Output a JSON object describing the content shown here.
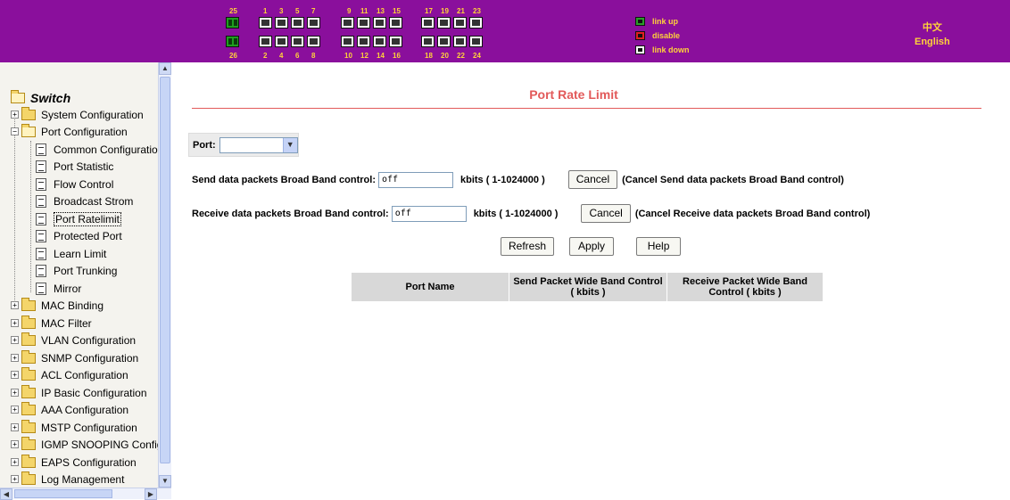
{
  "topbar": {
    "ports_top_gig": "25",
    "ports_bottom_gig": "26",
    "top_numbers": [
      "1",
      "3",
      "5",
      "7",
      "9",
      "11",
      "13",
      "15",
      "17",
      "19",
      "21",
      "23"
    ],
    "bottom_numbers": [
      "2",
      "4",
      "6",
      "8",
      "10",
      "12",
      "14",
      "16",
      "18",
      "20",
      "22",
      "24"
    ],
    "legend": [
      {
        "label": "link up",
        "color": "#2a9d2a"
      },
      {
        "label": "disable",
        "color": "#e02020"
      },
      {
        "label": "link down",
        "color": "#ffffff"
      }
    ],
    "lang_chinese": "中文",
    "lang_english": "English",
    "colors": {
      "bar": "#8a0f9c",
      "text": "#ffd23a"
    }
  },
  "sidebar": {
    "root_label": "Switch",
    "items": [
      {
        "label": "System Configuration",
        "type": "folder",
        "expanded": false
      },
      {
        "label": "Port Configuration",
        "type": "folder",
        "expanded": true
      },
      {
        "label": "Common Configuration",
        "type": "doc"
      },
      {
        "label": "Port Statistic",
        "type": "doc"
      },
      {
        "label": "Flow Control",
        "type": "doc"
      },
      {
        "label": "Broadcast Strom",
        "type": "doc"
      },
      {
        "label": "Port Ratelimit",
        "type": "doc",
        "selected": true
      },
      {
        "label": "Protected Port",
        "type": "doc"
      },
      {
        "label": "Learn Limit",
        "type": "doc"
      },
      {
        "label": "Port Trunking",
        "type": "doc"
      },
      {
        "label": "Mirror",
        "type": "doc"
      },
      {
        "label": "MAC Binding",
        "type": "folder",
        "expanded": false
      },
      {
        "label": "MAC Filter",
        "type": "folder",
        "expanded": false
      },
      {
        "label": "VLAN Configuration",
        "type": "folder",
        "expanded": false
      },
      {
        "label": "SNMP Configuration",
        "type": "folder",
        "expanded": false
      },
      {
        "label": "ACL Configuration",
        "type": "folder",
        "expanded": false
      },
      {
        "label": "IP Basic Configuration",
        "type": "folder",
        "expanded": false
      },
      {
        "label": "AAA Configuration",
        "type": "folder",
        "expanded": false
      },
      {
        "label": "MSTP Configuration",
        "type": "folder",
        "expanded": false
      },
      {
        "label": "IGMP SNOOPING Config",
        "type": "folder",
        "expanded": false
      },
      {
        "label": "EAPS Configuration",
        "type": "folder",
        "expanded": false
      },
      {
        "label": "Log Management",
        "type": "folder",
        "expanded": false
      }
    ]
  },
  "main": {
    "title": "Port Rate Limit",
    "port_label": "Port:",
    "port_selected": "",
    "send": {
      "label": "Send data packets Broad Band control:",
      "value": "off",
      "unit": "kbits ( 1-1024000 )",
      "cancel_label": "Cancel",
      "note": "(Cancel Send data packets Broad Band control)"
    },
    "receive": {
      "label": "Receive data packets Broad Band control:",
      "value": "off",
      "unit": "kbits ( 1-1024000 )",
      "cancel_label": "Cancel",
      "note": "(Cancel Receive data packets Broad Band control)"
    },
    "buttons": {
      "refresh": "Refresh",
      "apply": "Apply",
      "help": "Help"
    },
    "table": {
      "col_port_name": "Port Name",
      "col_send_1": "Send Packet Wide Band Control",
      "col_send_2": "( kbits )",
      "col_recv_1": "Receive Packet Wide Band",
      "col_recv_2": "Control ( kbits )"
    },
    "colors": {
      "title": "#e25a5a"
    }
  }
}
